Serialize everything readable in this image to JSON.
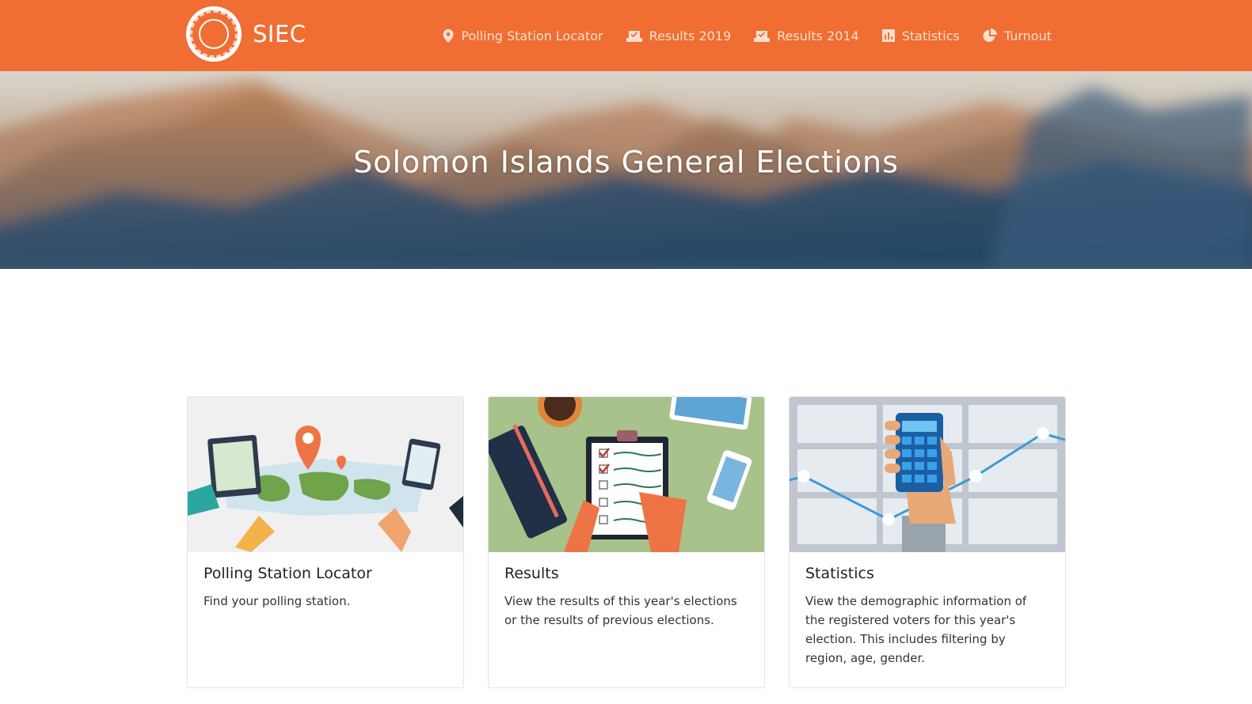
{
  "header": {
    "brand": "SIEC",
    "nav": [
      {
        "label": "Polling Station Locator",
        "icon": "map-marker-icon"
      },
      {
        "label": "Results 2019",
        "icon": "ballot-box-icon"
      },
      {
        "label": "Results 2014",
        "icon": "ballot-box-icon"
      },
      {
        "label": "Statistics",
        "icon": "bar-chart-icon"
      },
      {
        "label": "Turnout",
        "icon": "pie-chart-icon"
      }
    ]
  },
  "hero": {
    "title": "Solomon Islands General Elections"
  },
  "cards": [
    {
      "title": "Polling Station Locator",
      "text": "Find your polling station.",
      "image": "world-map-illustration"
    },
    {
      "title": "Results",
      "text": "View the results of this year's elections or the results of previous elections.",
      "image": "clipboard-checklist-illustration"
    },
    {
      "title": "Statistics",
      "text": "View the demographic information of the registered voters for this year's election. This includes filtering by region, age, gender.",
      "image": "calculator-graph-illustration"
    }
  ],
  "colors": {
    "brand": "#f06d33",
    "nav_text": "#ffe0d0"
  }
}
